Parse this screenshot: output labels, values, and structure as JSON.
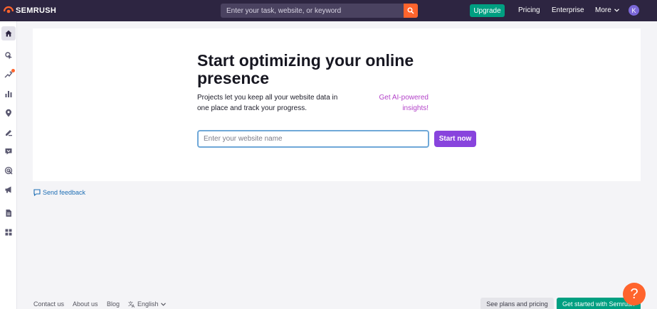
{
  "header": {
    "brand": "SEMRUSH",
    "search_placeholder": "Enter your task, website, or keyword",
    "upgrade_label": "Upgrade",
    "nav": [
      "Pricing",
      "Enterprise"
    ],
    "more_label": "More",
    "avatar_initial": "K"
  },
  "colors": {
    "topbar": "#2d2541",
    "accent_orange": "#ff642d",
    "accent_green": "#009f81",
    "accent_purple": "#8844dd",
    "link_magenta": "#b343c9"
  },
  "sidebar": {
    "items": [
      {
        "icon": "home-icon",
        "active": true
      },
      {
        "icon": "seo-icon"
      },
      {
        "icon": "ai-sparkle-icon",
        "badge": true
      },
      {
        "icon": "bar-chart-icon"
      },
      {
        "icon": "location-pin-icon"
      },
      {
        "icon": "content-pen-icon"
      },
      {
        "icon": "chat-bubble-icon"
      },
      {
        "icon": "target-icon"
      },
      {
        "icon": "megaphone-icon"
      },
      {
        "icon": "report-document-icon"
      },
      {
        "icon": "apps-grid-icon"
      }
    ]
  },
  "main": {
    "headline": "Start optimizing your online presence",
    "description": "Projects let you keep all your website data in one place and track your progress.",
    "ai_link": "Get AI-powered insights!",
    "input_placeholder": "Enter your website name",
    "start_button": "Start now",
    "feedback_label": "Send feedback"
  },
  "footer": {
    "links": [
      "Contact us",
      "About us",
      "Blog"
    ],
    "language": "English",
    "plans_button": "See plans and pricing",
    "get_started_button": "Get started with Semrush",
    "help_label": "?"
  }
}
